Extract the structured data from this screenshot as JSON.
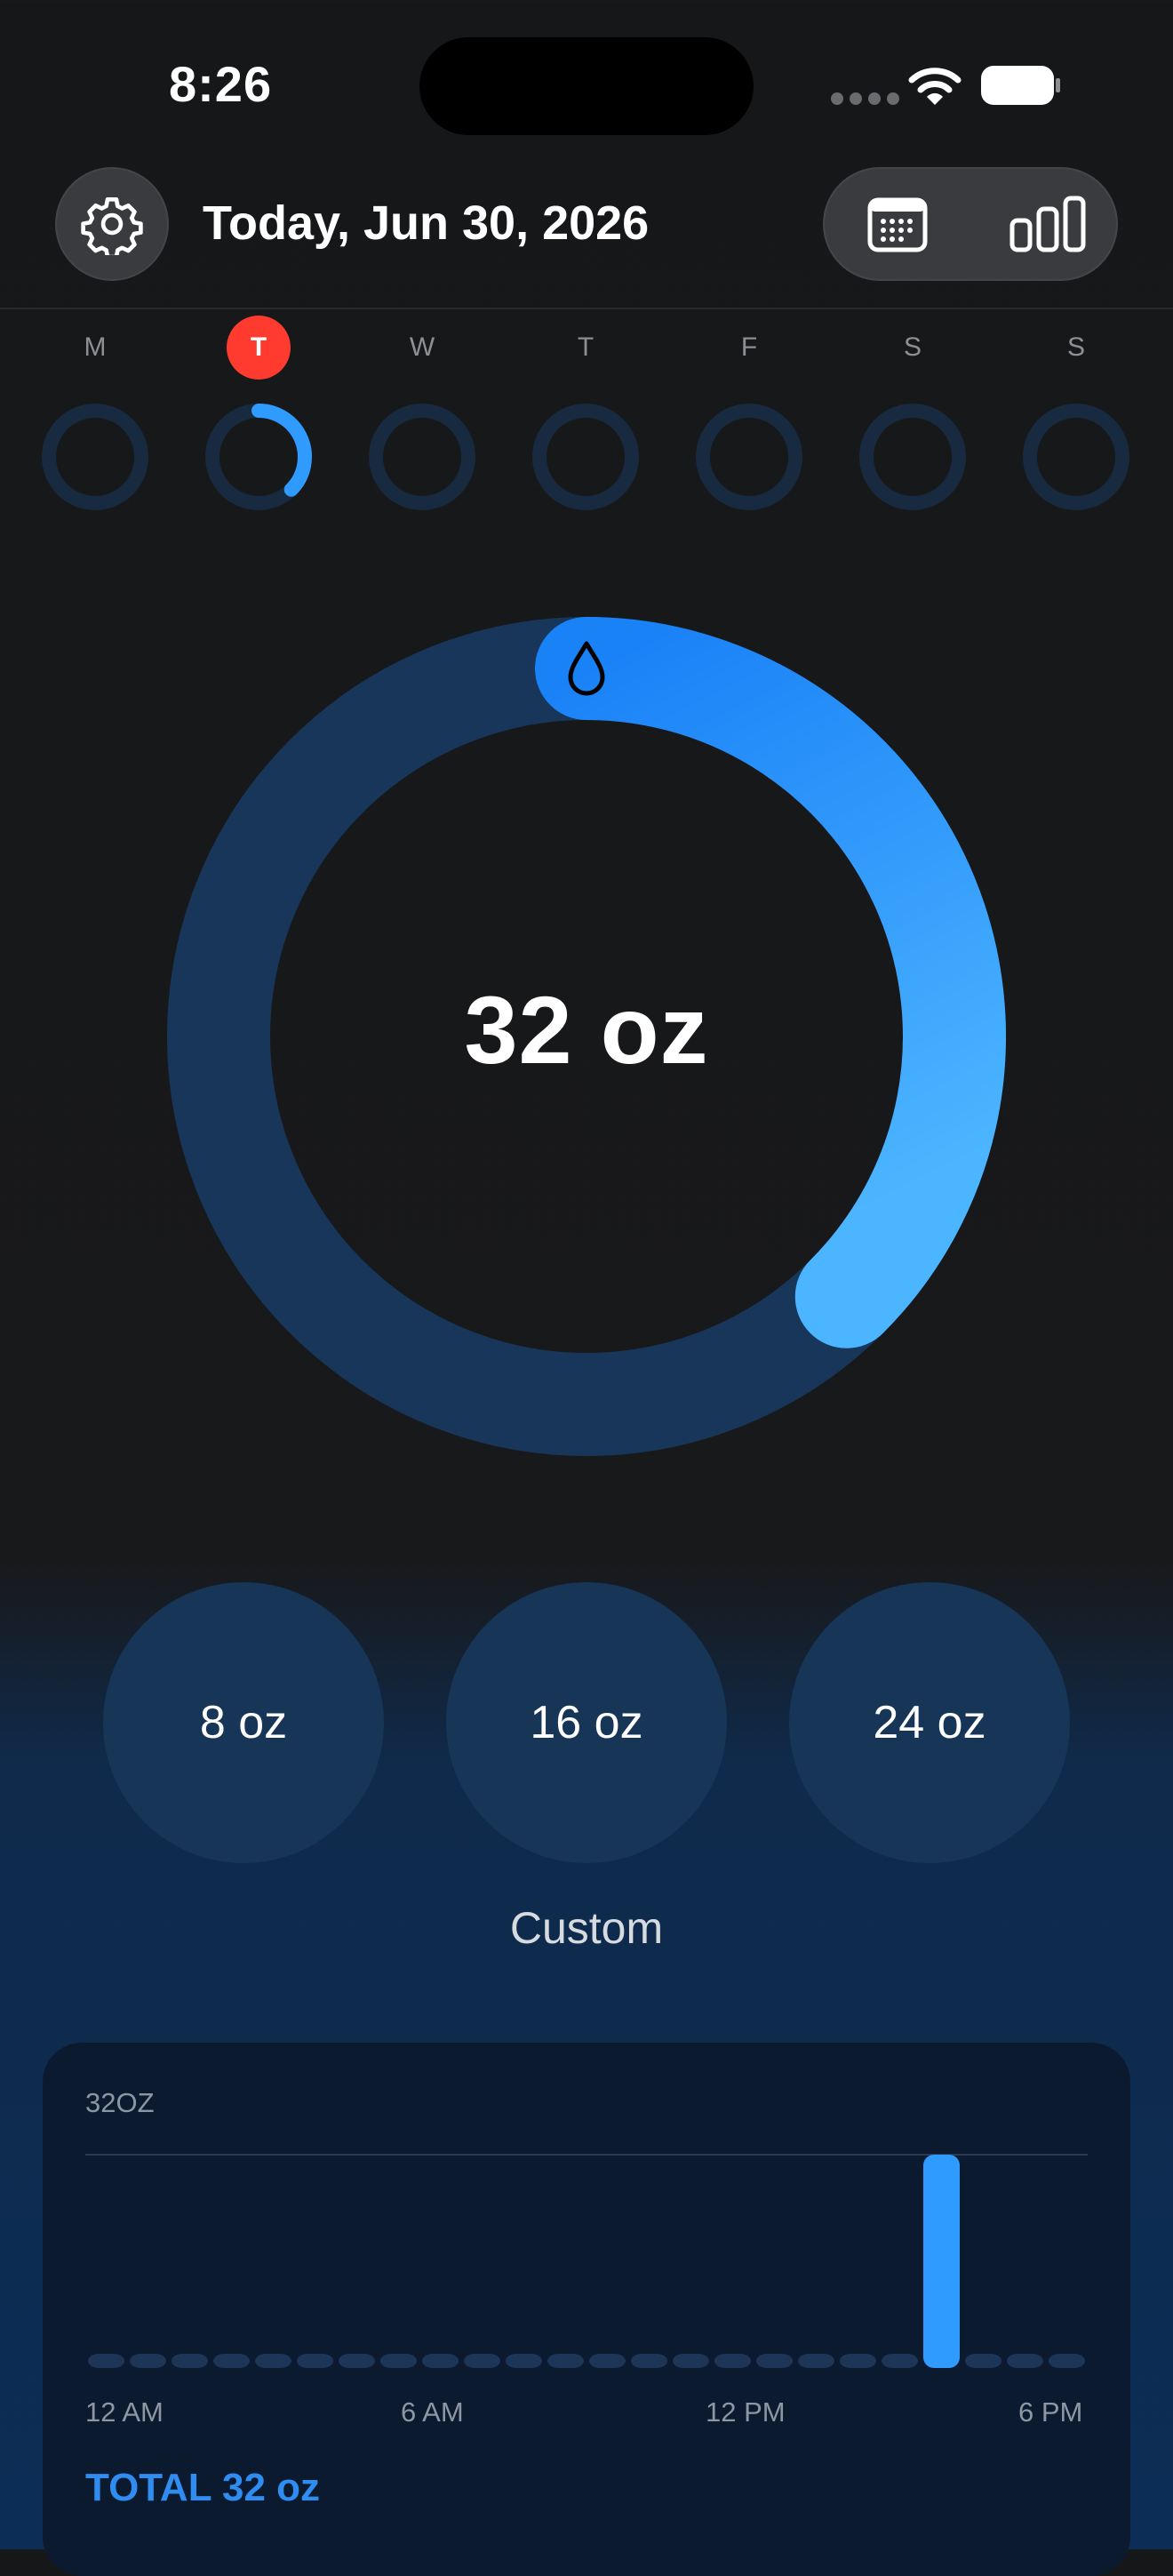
{
  "status_bar": {
    "time": "8:26"
  },
  "header": {
    "settings_icon": "gear-icon",
    "date_title": "Today, Jun 30, 2026",
    "view_calendar_icon": "calendar-icon",
    "view_stats_icon": "bar-chart-icon"
  },
  "week": {
    "days": [
      {
        "letter": "M",
        "progress": 0
      },
      {
        "letter": "T",
        "progress": 0.375,
        "today": true
      },
      {
        "letter": "W",
        "progress": 0
      },
      {
        "letter": "T",
        "progress": 0
      },
      {
        "letter": "F",
        "progress": 0
      },
      {
        "letter": "S",
        "progress": 0
      },
      {
        "letter": "S",
        "progress": 0
      }
    ]
  },
  "intake": {
    "amount_label": "32 oz",
    "progress": 0.375,
    "icon": "water-drop-icon"
  },
  "quick_add": {
    "buttons": [
      "8 oz",
      "16 oz",
      "24 oz"
    ],
    "custom_label": "Custom"
  },
  "chart_data": {
    "type": "bar",
    "y_max_label": "32OZ",
    "x_tick_labels": [
      "12 AM",
      "6 AM",
      "12 PM",
      "6 PM"
    ],
    "bucket_count": 24,
    "values": [
      0,
      0,
      0,
      0,
      0,
      0,
      0,
      0,
      0,
      0,
      0,
      0,
      0,
      0,
      0,
      0,
      0,
      0,
      0,
      0,
      32,
      0,
      0,
      0
    ],
    "ylim": [
      0,
      32
    ],
    "total_label": "TOTAL 32 oz"
  },
  "colors": {
    "accent_blue": "#1a82f7",
    "accent_light_blue": "#4cb5ff",
    "ring_track": "#173659",
    "today_red": "#ff3b30"
  }
}
